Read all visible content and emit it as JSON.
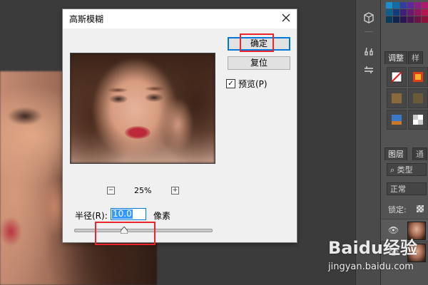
{
  "dialog": {
    "title": "高斯模糊",
    "ok_label": "确定",
    "reset_label": "复位",
    "preview_label": "预览(P)",
    "preview_checked": true,
    "zoom": {
      "value": "25%",
      "minus": "−",
      "plus": "+"
    },
    "radius": {
      "label": "半径(R):",
      "value": "10.0",
      "unit": "像素",
      "slider_fraction": 0.36
    }
  },
  "right_panel": {
    "tab_adjust": "调整",
    "tab_styles": "样",
    "tab_layers": "图层",
    "tab_channels": "通",
    "layer_filter": "类型",
    "blend_mode": "正常",
    "lock_label": "锁定:",
    "swatch_colors": [
      "#1a8fd0",
      "#0e6fa8",
      "#2e3fa0",
      "#5d2a9b",
      "#8a1f82",
      "#b2196e",
      "#000000",
      "#1e1e1e",
      "#0f5e8c",
      "#123c7a",
      "#3d1f7a",
      "#6a1a6e",
      "#94155e",
      "#b81452",
      "#3a3a3a",
      "#5a5a5a",
      "#0a3b5c",
      "#0f2550",
      "#2a1554",
      "#4a1450",
      "#6d1245",
      "#8e103b",
      "#777777",
      "#999999"
    ]
  },
  "colors": {
    "accent": "#0078d7",
    "highlight_red": "#e8262b",
    "dialog_bg": "#f0f0f0"
  },
  "watermark": {
    "logo": "Baidu经验",
    "url": "jingyan.baidu.com"
  }
}
